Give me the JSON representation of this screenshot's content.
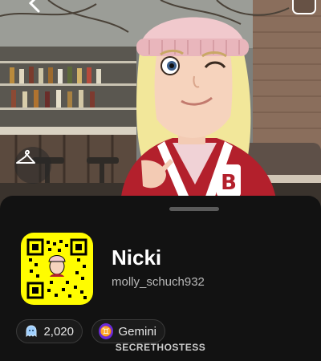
{
  "profile": {
    "display_name": "Nicki",
    "username": "molly_schuch932",
    "snap_score": "2,020",
    "zodiac": "Gemini",
    "zodiac_symbol": "♊"
  },
  "watermark": "SECRETHOSTESS",
  "colors": {
    "snapchat_yellow": "#FFFC00",
    "sheet_background": "#121212",
    "zodiac_purple": "#6b2bd9",
    "jacket_red": "#b3202c",
    "beanie_pink": "#f1c9cd"
  },
  "icons": {
    "back": "chevron-left-icon",
    "outfit": "hanger-icon",
    "score": "ghost-icon",
    "zodiac": "gemini-icon"
  }
}
